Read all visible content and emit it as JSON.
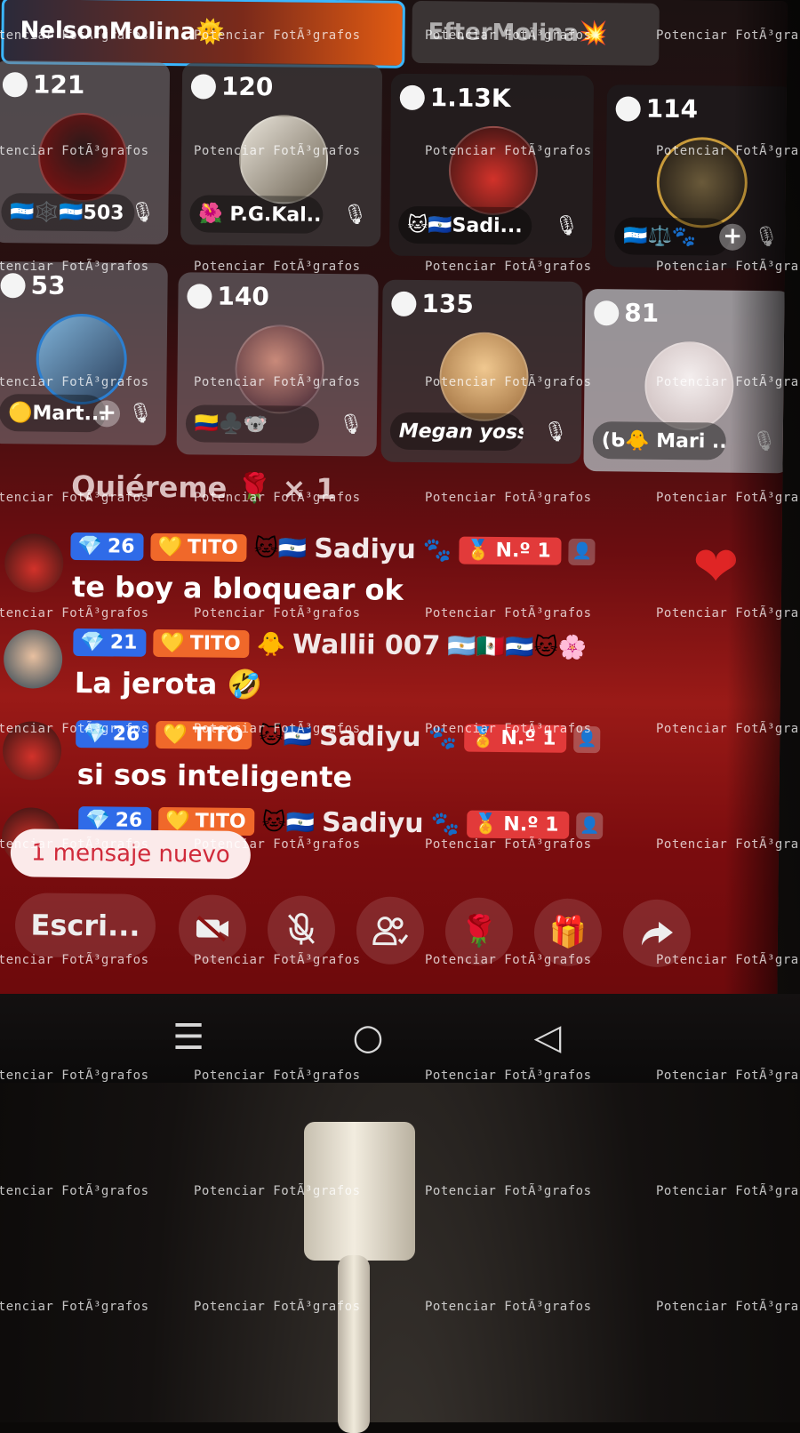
{
  "banners": {
    "left_name": "NelsonMolina",
    "left_emoji": "🌞",
    "right_name": "EfterMolina",
    "right_emoji": "💥"
  },
  "seats": [
    {
      "count": "121",
      "name": "🇭🇳🕸️🇭🇳503",
      "muted": true
    },
    {
      "count": "120",
      "name": "🌺 P.G.Kal...",
      "muted": true
    },
    {
      "count": "1.13K",
      "name": "🐱🇸🇻Sadi...",
      "muted": true
    },
    {
      "count": "114",
      "name": "🇭🇳⚖️🐾",
      "muted": true,
      "plus": true
    },
    {
      "count": "53",
      "name": "🟡Mart...",
      "muted": true,
      "plus": true
    },
    {
      "count": "140",
      "name": "🇨🇴♣️🐨",
      "muted": true
    },
    {
      "count": "135",
      "name": "Megan yoss...",
      "muted": true
    },
    {
      "count": "81",
      "name": "(ᑲ🐥 Mari ...",
      "muted": true
    }
  ],
  "gift_note": "Quiéreme 🌹 × 1",
  "messages": [
    {
      "gem": "26",
      "tito": "TITO",
      "emoji": "🐱🇸🇻",
      "user": "Sadiyu",
      "paw": "🐾",
      "rank": "N.º 1",
      "text": "te boy a bloquear ok"
    },
    {
      "gem": "21",
      "tito": "TITO",
      "emoji": "🐥",
      "user": "Wallii 007",
      "flags": "🇦🇷🇲🇽🇸🇻🐱🌸",
      "text": "La jerota 🤣"
    },
    {
      "gem": "26",
      "tito": "TITO",
      "emoji": "🐱🇸🇻",
      "user": "Sadiyu",
      "paw": "🐾",
      "rank": "N.º 1",
      "text": "si sos inteligente"
    },
    {
      "gem": "26",
      "tito": "TITO",
      "emoji": "🐱🇸🇻",
      "user": "Sadiyu",
      "paw": "🐾",
      "rank": "N.º 1",
      "text": ""
    }
  ],
  "new_message_label": "1 mensaje nuevo",
  "input_placeholder": "Escri...",
  "toolbar_icons": [
    "camera-off-icon",
    "mic-off-icon",
    "users-icon",
    "rose-icon",
    "gift-icon",
    "share-icon"
  ],
  "nav": {
    "menu": "☰",
    "home": "○",
    "back": "◁"
  },
  "watermark": "Potenciar FotÃ³grafos",
  "colors": {
    "gem_badge": "#2f6be8",
    "tito_badge": "#f0682a",
    "rank_badge": "#e23a3a",
    "heart": "#e02525"
  }
}
